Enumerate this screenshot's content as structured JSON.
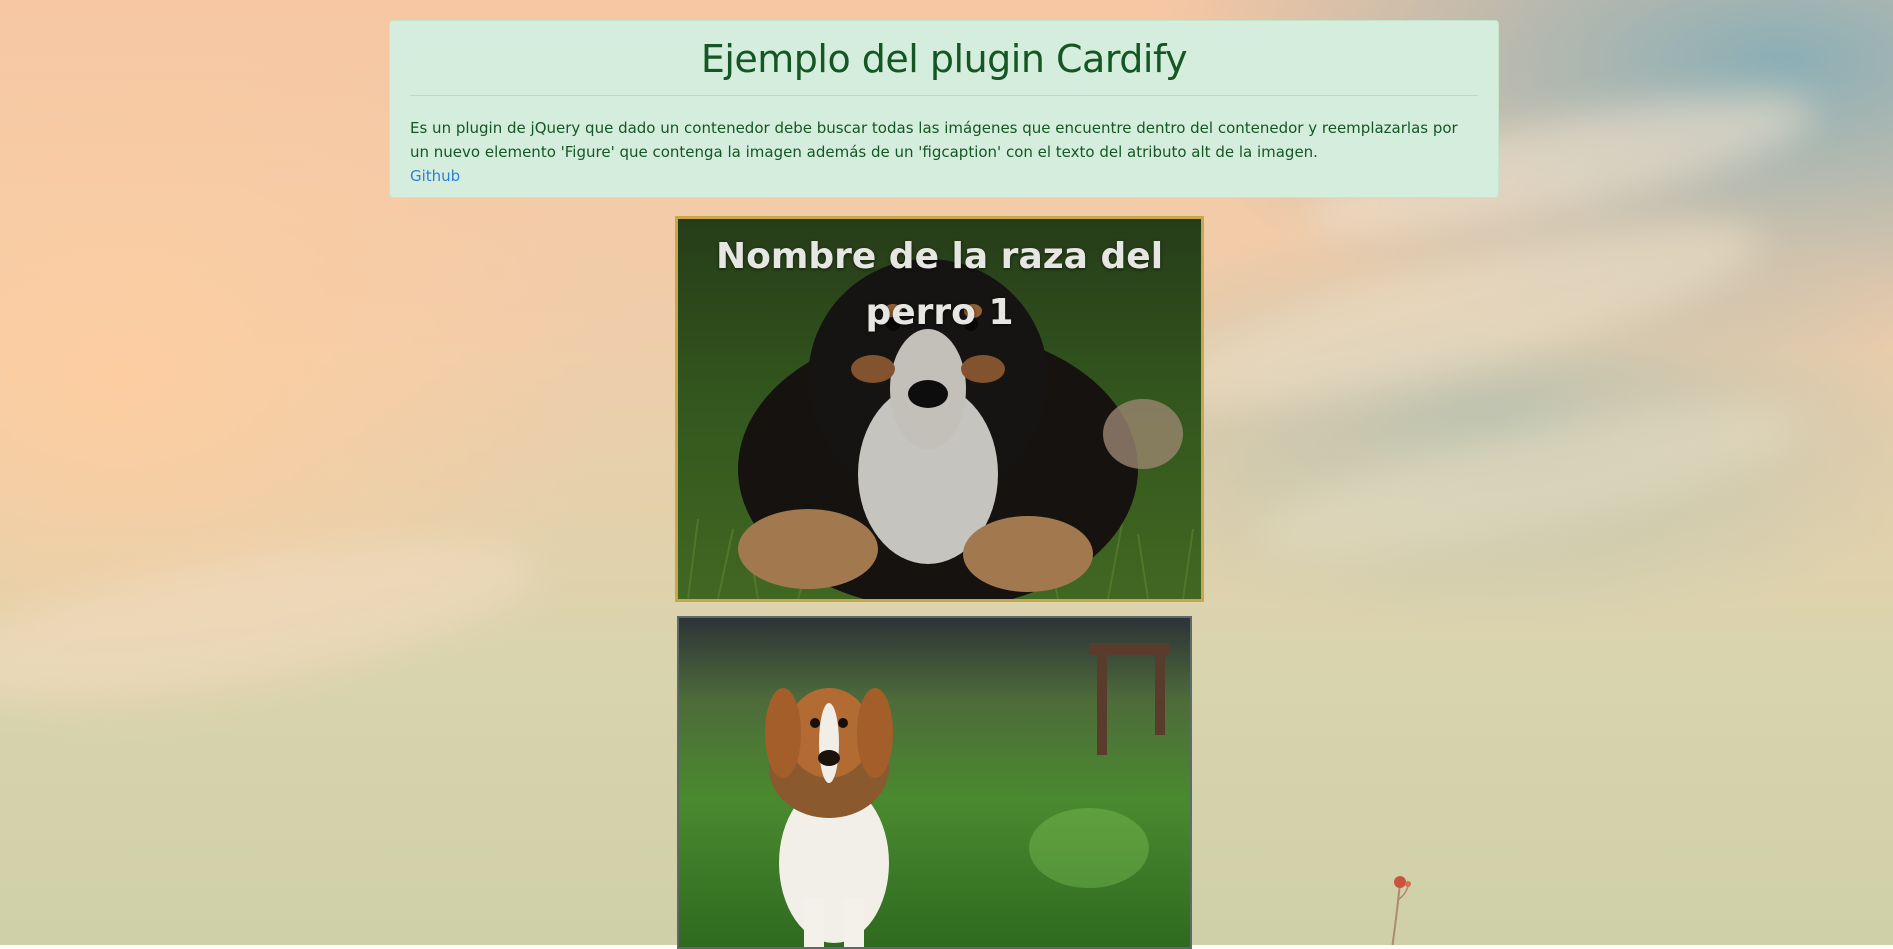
{
  "header": {
    "title": "Ejemplo del plugin Cardify",
    "description": "Es un plugin de jQuery que dado un contenedor debe buscar todas las imágenes que encuentre dentro del contenedor y reemplazarlas por un nuevo elemento 'Figure' que contenga la imagen además de un 'figcaption' con el texto del atributo alt de la imagen.",
    "link_label": "Github"
  },
  "figures": [
    {
      "caption": "Nombre de la raza del perro 1",
      "image": "bernese-puppy-photo",
      "border_color": "#c9a64a"
    },
    {
      "caption": "",
      "image": "beagle-photo",
      "border_color": "#5d6a6a"
    }
  ],
  "colors": {
    "alert_bg": "#d4eddc",
    "alert_text": "#155724",
    "link": "#2d7fdb",
    "caption_text": "#e6e6e2"
  }
}
